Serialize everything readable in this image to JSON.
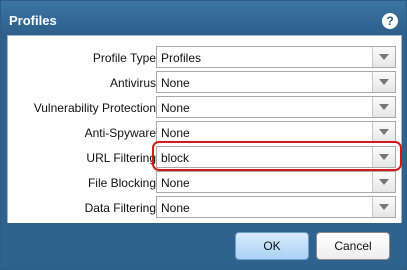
{
  "dialog": {
    "title": "Profiles",
    "help_icon_text": "?"
  },
  "fields": [
    {
      "label": "Profile Type",
      "value": "Profiles"
    },
    {
      "label": "Antivirus",
      "value": "None"
    },
    {
      "label": "Vulnerability Protection",
      "value": "None"
    },
    {
      "label": "Anti-Spyware",
      "value": "None"
    },
    {
      "label": "URL Filtering",
      "value": "block"
    },
    {
      "label": "File Blocking",
      "value": "None"
    },
    {
      "label": "Data Filtering",
      "value": "None"
    }
  ],
  "buttons": {
    "ok": "OK",
    "cancel": "Cancel"
  },
  "colors": {
    "header": "#2f628c",
    "highlight": "#d11b1b"
  },
  "icons": {
    "help": "help-icon",
    "dropdown": "chevron-down-icon"
  }
}
